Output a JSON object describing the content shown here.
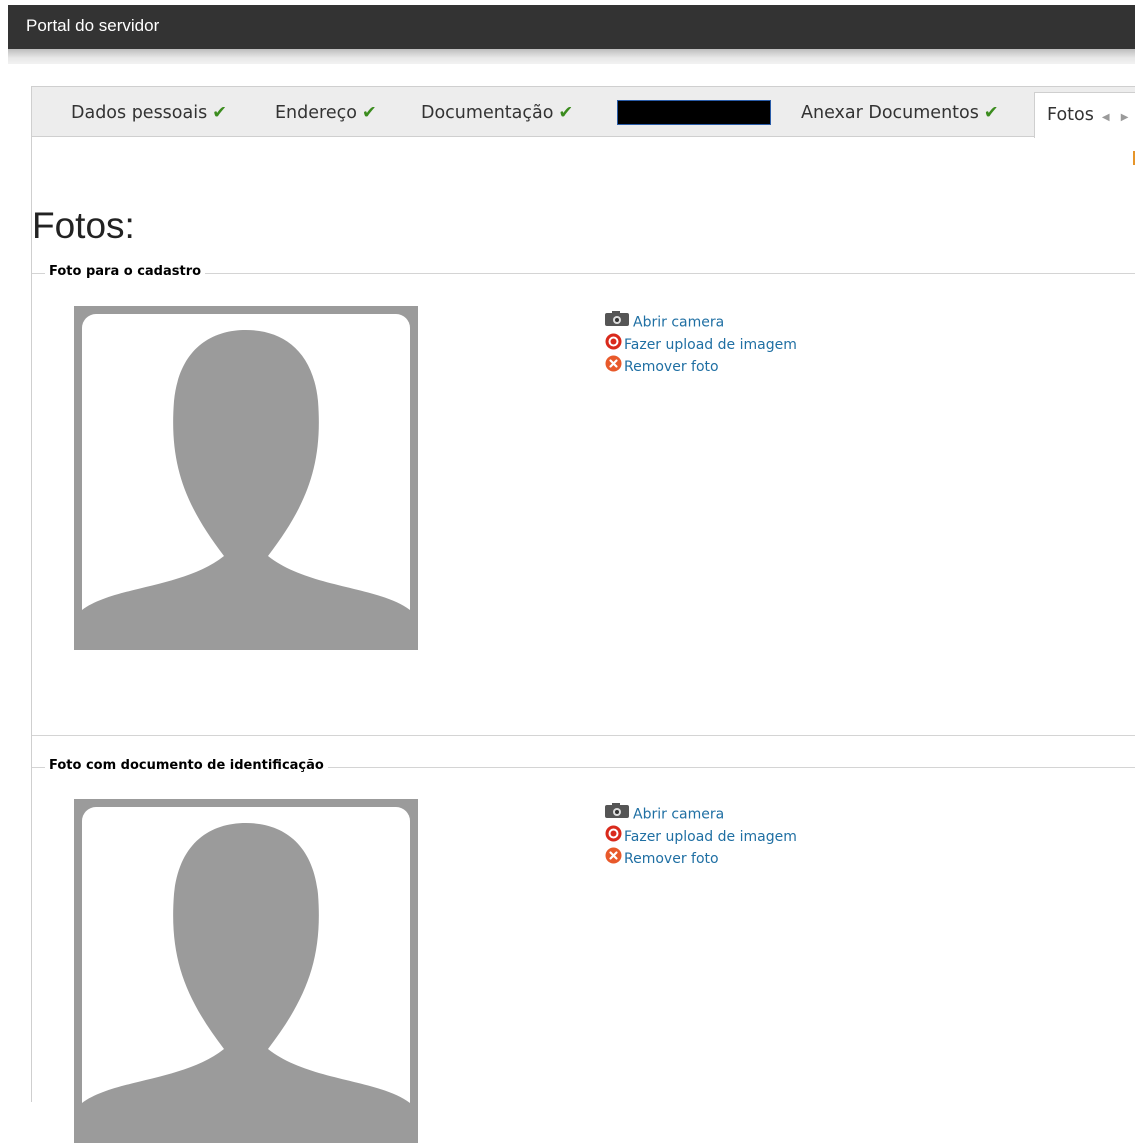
{
  "app": {
    "title": "Portal do servidor"
  },
  "tabs": [
    {
      "label": "Dados pessoais",
      "status": "complete"
    },
    {
      "label": "Endereço",
      "status": "complete"
    },
    {
      "label": "Documentação",
      "status": "complete"
    },
    {
      "label": "",
      "status": "redacted"
    },
    {
      "label": "Anexar Documentos",
      "status": "complete"
    },
    {
      "label": "Fotos",
      "status": "active"
    }
  ],
  "page": {
    "title": "Fotos:"
  },
  "sections": [
    {
      "legend": "Foto para o cadastro",
      "actions": {
        "camera": "Abrir camera",
        "upload": "Fazer upload de imagem",
        "remove": "Remover foto"
      }
    },
    {
      "legend": "Foto com documento de identificação",
      "actions": {
        "camera": "Abrir camera",
        "upload": "Fazer upload de imagem",
        "remove": "Remover foto"
      }
    }
  ],
  "colors": {
    "topbar": "#333333",
    "link": "#1f6fa3",
    "check": "#3b8c1e",
    "placeholder": "#9b9b9b"
  },
  "icons": {
    "check": "checkmark-icon",
    "camera": "camera-icon",
    "upload": "upload-icon",
    "remove": "remove-icon",
    "scroll": "tab-scroll-arrows-icon"
  }
}
